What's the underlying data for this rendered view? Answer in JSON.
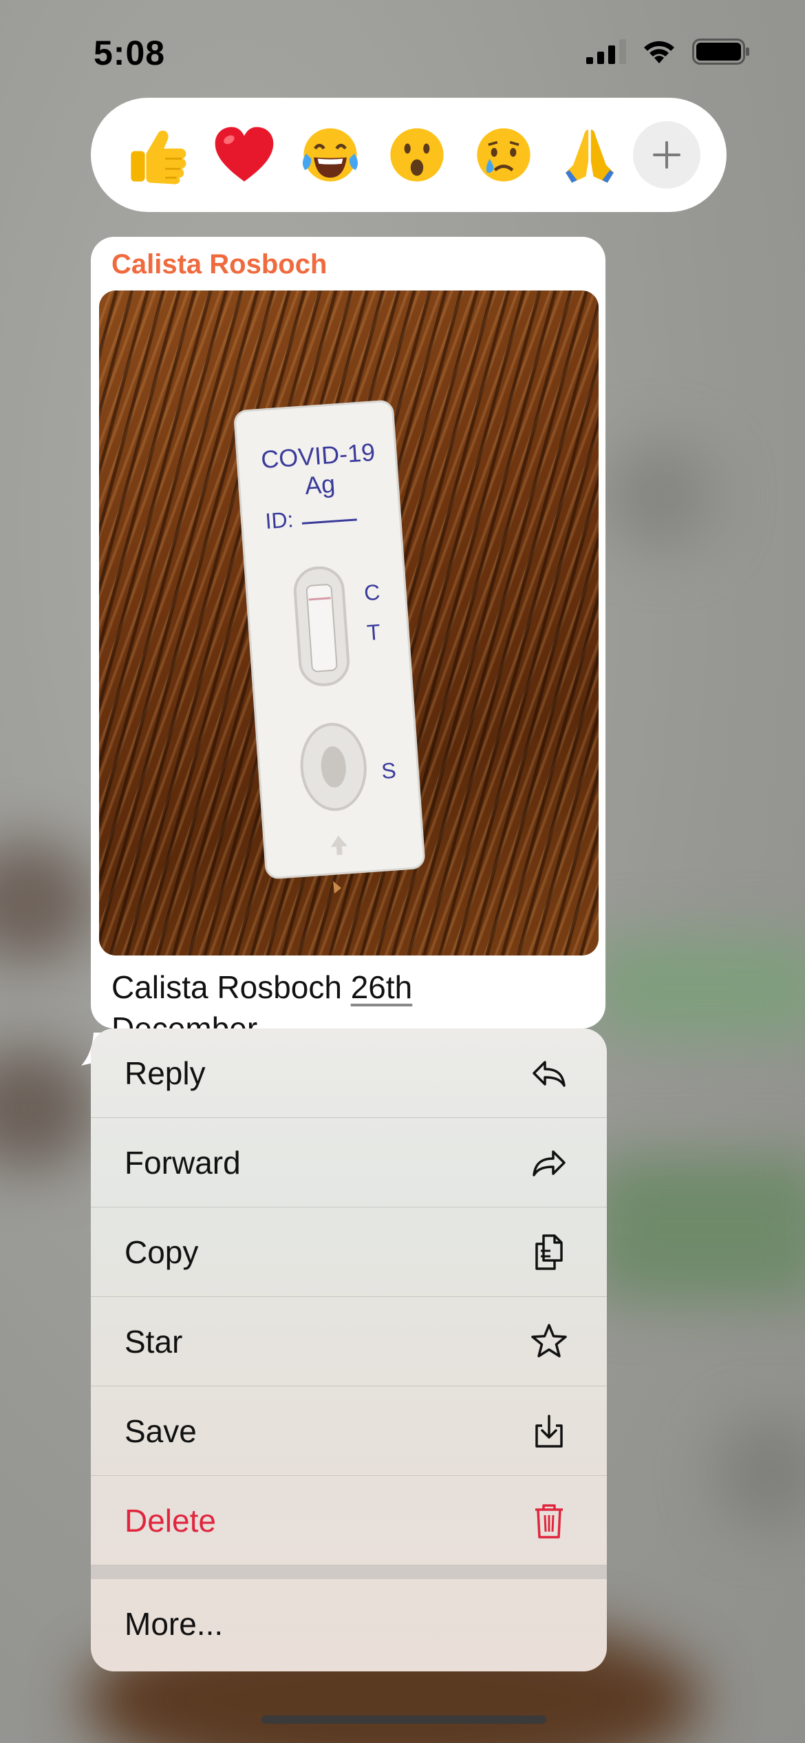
{
  "status_bar": {
    "time": "5:08"
  },
  "reactions": {
    "items": [
      {
        "name": "thumbs-up",
        "glyph": "👍"
      },
      {
        "name": "red-heart",
        "glyph": "❤️"
      },
      {
        "name": "tears-of-joy",
        "glyph": "😂"
      },
      {
        "name": "surprised",
        "glyph": "😮"
      },
      {
        "name": "crying",
        "glyph": "😢"
      },
      {
        "name": "folded-hands",
        "glyph": "🙏"
      }
    ],
    "more_icon": "plus-icon"
  },
  "message": {
    "sender": "Calista Rosboch",
    "photo": {
      "test_title": "COVID-19",
      "test_subtitle": "Ag",
      "test_id_label": "ID:",
      "marker_c": "C",
      "marker_t": "T",
      "marker_s": "S"
    },
    "caption_name": "Calista Rosboch",
    "caption_date": "26th",
    "caption_date_cont": "December"
  },
  "menu": {
    "items": [
      {
        "label": "Reply",
        "icon": "reply-icon"
      },
      {
        "label": "Forward",
        "icon": "forward-icon"
      },
      {
        "label": "Copy",
        "icon": "copy-icon"
      },
      {
        "label": "Star",
        "icon": "star-icon"
      },
      {
        "label": "Save",
        "icon": "save-icon"
      },
      {
        "label": "Delete",
        "icon": "trash-icon"
      }
    ],
    "more_label": "More..."
  },
  "colors": {
    "sender": "#ef6a3d",
    "delete": "#e0263f"
  }
}
